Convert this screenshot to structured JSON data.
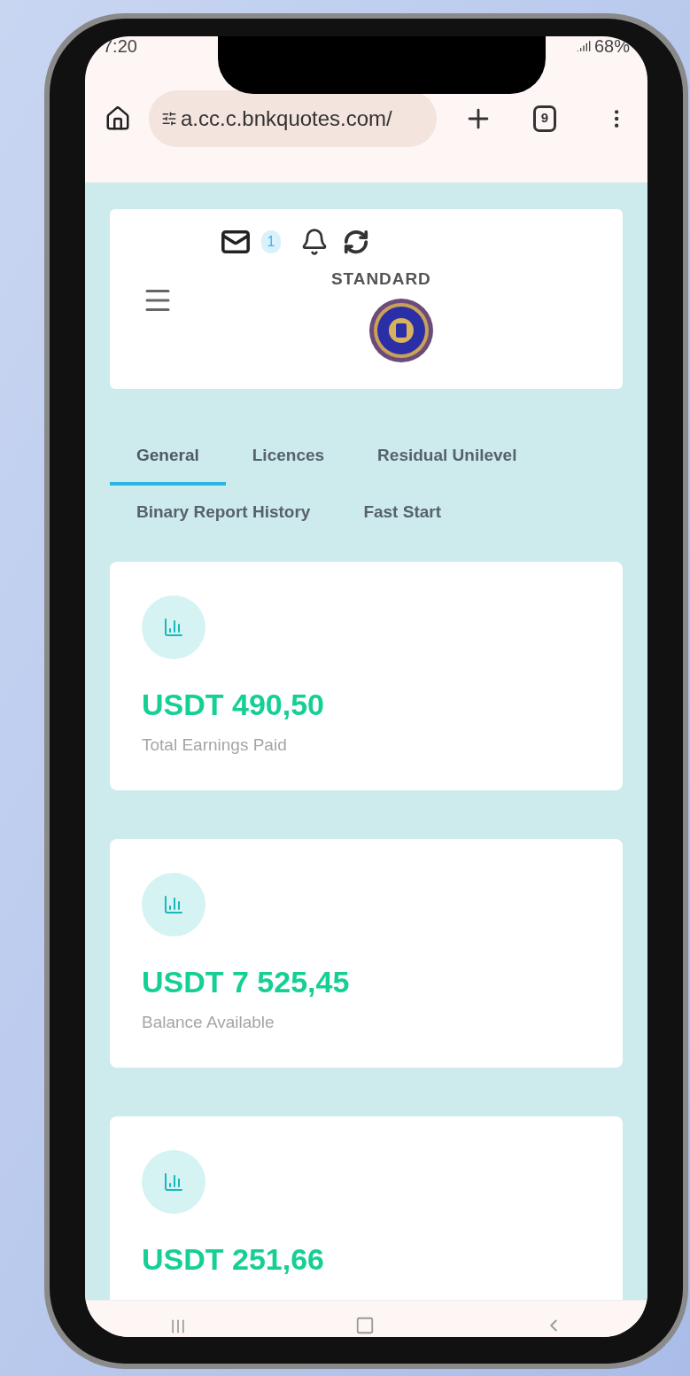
{
  "status_bar": {
    "time": "7:20",
    "battery": "68%"
  },
  "browser": {
    "url": "a.cc.c.bnkquotes.com/",
    "tab_count": "9"
  },
  "header": {
    "badge": "1",
    "plan": "STANDARD"
  },
  "tabs": [
    {
      "label": "General",
      "selected": true
    },
    {
      "label": "Licences",
      "selected": false
    },
    {
      "label": "Residual Unilevel",
      "selected": false
    },
    {
      "label": "Binary Report History",
      "selected": false
    },
    {
      "label": "Fast Start",
      "selected": false
    }
  ],
  "cards": [
    {
      "value": "USDT 490,50",
      "label": "Total Earnings Paid"
    },
    {
      "value": "USDT 7 525,45",
      "label": "Balance Available"
    },
    {
      "value": "USDT 251,66"
    }
  ]
}
